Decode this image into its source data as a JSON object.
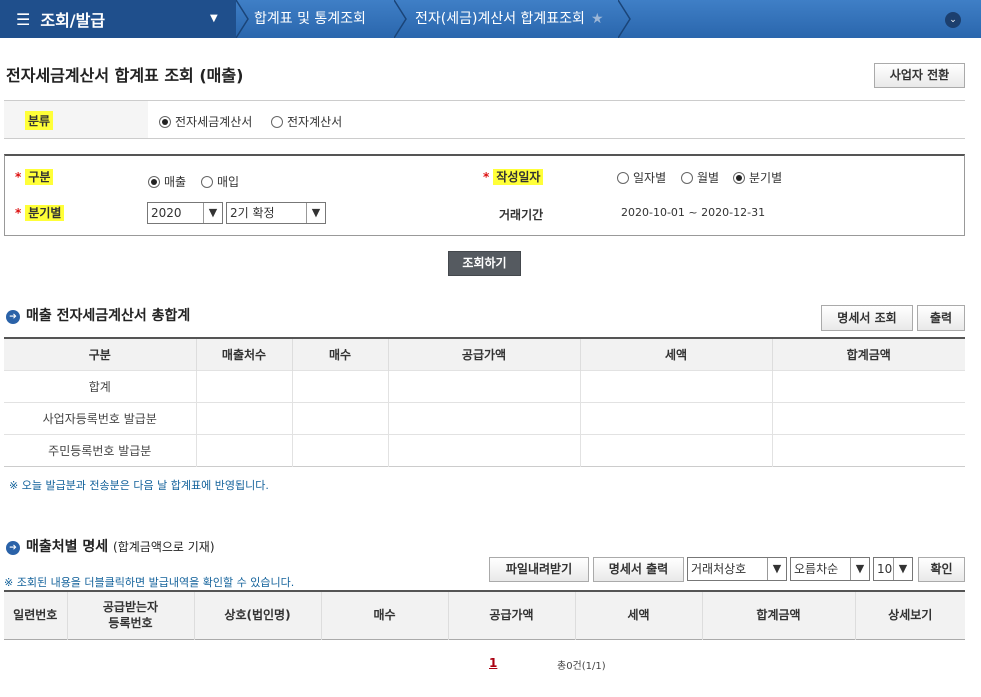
{
  "nav": {
    "menu_title": "조회/발급",
    "breadcrumbs": [
      "합계표 및 통계조회",
      "전자(세금)계산서 합계표조회"
    ]
  },
  "page_title": "전자세금계산서 합계표 조회 (매출)",
  "switch_business_label": "사업자 전환",
  "category": {
    "label": "분류",
    "options": [
      "전자세금계산서",
      "전자계산서"
    ],
    "selected": "전자세금계산서"
  },
  "search": {
    "type_label": "구분",
    "type_options": [
      "매출",
      "매입"
    ],
    "date_label": "작성일자",
    "date_options": [
      "일자별",
      "월별",
      "분기별"
    ],
    "quarter_label": "분기별",
    "year_value": "2020",
    "quarter_value": "2기 확정",
    "period_label": "거래기간",
    "period_value": "2020-10-01 ~ 2020-12-31"
  },
  "search_button_label": "조회하기",
  "summary": {
    "title": "매출 전자세금계산서 총합계",
    "detail_button": "명세서 조회",
    "print_button": "출력",
    "columns": [
      "구분",
      "매출처수",
      "매수",
      "공급가액",
      "세액",
      "합계금액"
    ],
    "rows": [
      "합계",
      "사업자등록번호 발급분",
      "주민등록번호 발급분"
    ],
    "note": "※ 오늘 발급분과 전송분은 다음 날 합계표에 반영됩니다."
  },
  "detail": {
    "title": "매출처별 명세",
    "subtitle": "(합계금액으로 기재)",
    "note": "※ 조회된 내용을 더블클릭하면 발급내역을 확인할 수 있습니다.",
    "download_button": "파일내려받기",
    "print_button": "명세서 출력",
    "sort_field": "거래처상호",
    "sort_order": "오름차순",
    "page_size": "10",
    "confirm_button": "확인",
    "columns": [
      "일련번호",
      "공급받는자\n등록번호",
      "상호(법인명)",
      "매수",
      "공급가액",
      "세액",
      "합계금액",
      "상세보기"
    ],
    "page": "1",
    "total": "총0건(1/1)"
  },
  "colors": {
    "nav_blue": "#2a66ad",
    "nav_dark": "#1f4f8c",
    "highlight": "#ffff38",
    "note_blue": "#13629b",
    "required_red": "#d11111"
  }
}
